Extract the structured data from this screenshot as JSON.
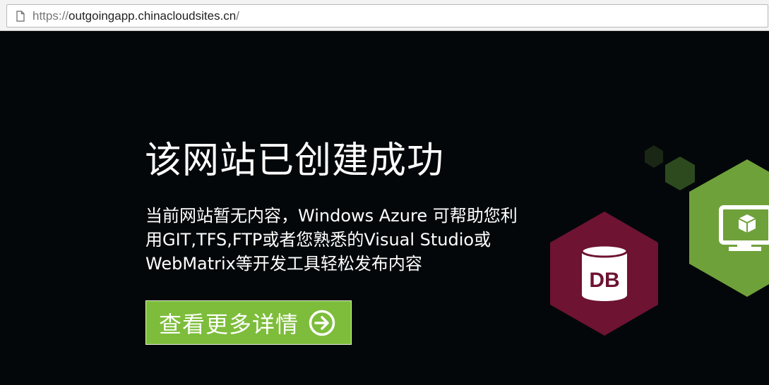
{
  "browser": {
    "url_scheme": "https://",
    "url_host": "outgoingapp.chinacloudsites.cn",
    "url_path": "/",
    "page_icon": "document-icon"
  },
  "hero": {
    "headline": "该网站已创建成功",
    "description_lines": [
      "当前网站暂无内容，Windows Azure 可帮助您利",
      "用GIT,TFS,FTP或者您熟悉的Visual Studio或",
      "WebMatrix等开发工具轻松发布内容"
    ],
    "button_label": "查看更多详情",
    "button_icon": "arrow-right-circle-icon"
  },
  "decor": {
    "db_badge_text": "DB",
    "db_icon": "database-icon",
    "monitor_icon": "monitor-cube-icon",
    "colors": {
      "background": "#03070a",
      "button_green": "#7dbd3b",
      "db_hexagon": "#6e1332",
      "monitor_hexagon": "#6fa13a",
      "small_hexagon": "#2d4a1f"
    }
  }
}
